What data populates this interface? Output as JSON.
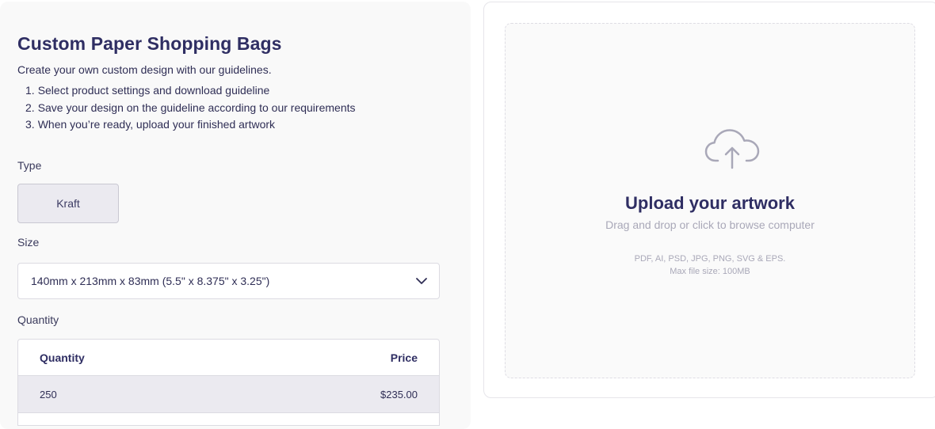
{
  "product": {
    "title": "Custom Paper Shopping Bags",
    "intro": "Create your own custom design with our guidelines.",
    "steps": [
      {
        "num": "1.",
        "text": "Select product settings and download guideline"
      },
      {
        "num": "2.",
        "text": "Save your design on the guideline according to our requirements"
      },
      {
        "num": "3.",
        "text": "When you’re ready, upload your finished artwork"
      }
    ]
  },
  "type": {
    "label": "Type",
    "selected": "Kraft"
  },
  "size": {
    "label": "Size",
    "selected": "140mm x 213mm x 83mm (5.5\" x 8.375\" x 3.25\")"
  },
  "quantity": {
    "label": "Quantity",
    "table": {
      "headers": {
        "quantity": "Quantity",
        "price": "Price"
      },
      "rows": [
        {
          "quantity": "250",
          "price": "$235.00"
        }
      ]
    }
  },
  "upload": {
    "icon": "cloud-upload-icon",
    "title": "Upload your artwork",
    "subtitle": "Drag and drop or click to browse computer",
    "file_types": "PDF, AI, PSD, JPG, PNG, SVG & EPS.",
    "max_size": "Max file size: 100MB"
  },
  "colors": {
    "primary_text": "#2f2e63",
    "muted_text": "#a9a8b8",
    "selected_bg": "#ebeaf0"
  }
}
